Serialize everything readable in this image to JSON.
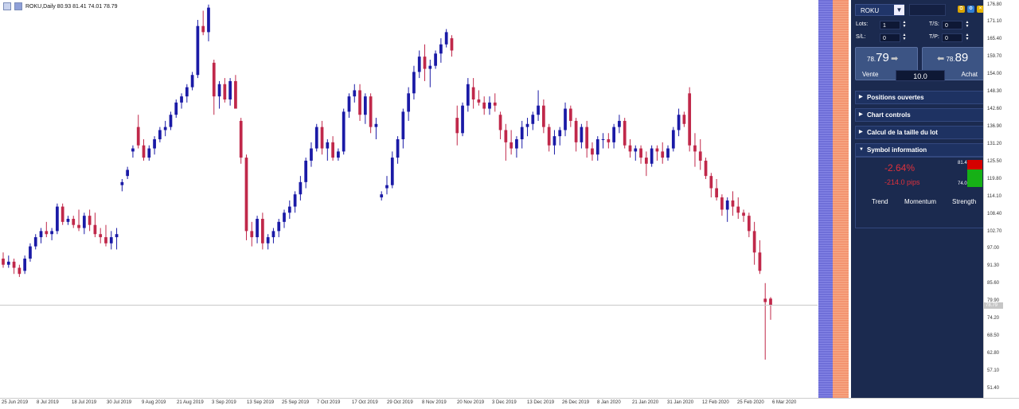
{
  "chart_header": {
    "text": "ROKU,Daily  80.93 81.41 74.01 78.79"
  },
  "price_axis": {
    "labels": [
      "176.80",
      "171.10",
      "165.40",
      "159.70",
      "154.00",
      "148.30",
      "142.60",
      "136.90",
      "131.20",
      "125.50",
      "119.80",
      "114.10",
      "108.40",
      "102.70",
      "97.00",
      "91.30",
      "85.60",
      "79.90",
      "74.20",
      "68.50",
      "62.80",
      "57.10",
      "51.40"
    ],
    "current": "78.79"
  },
  "time_axis": {
    "labels": [
      "25 Jun 2019",
      "8 Jul 2019",
      "18 Jul 2019",
      "30 Jul 2019",
      "9 Aug 2019",
      "21 Aug 2019",
      "3 Sep 2019",
      "13 Sep 2019",
      "25 Sep 2019",
      "7 Oct 2019",
      "17 Oct 2019",
      "29 Oct 2019",
      "8 Nov 2019",
      "20 Nov 2019",
      "3 Dec 2019",
      "13 Dec 2019",
      "26 Dec 2019",
      "8 Jan 2020",
      "21 Jan 2020",
      "31 Jan 2020",
      "12 Feb 2020",
      "25 Feb 2020",
      "6 Mar 2020"
    ]
  },
  "colors": {
    "bull": "#1a1aa6",
    "bear": "#c0284a",
    "panel_bg": "#1b2a4f"
  },
  "chart_data": {
    "type": "candlestick",
    "symbol": "ROKU",
    "timeframe": "Daily",
    "ylim": [
      48.5,
      178.5
    ],
    "last": {
      "open": 80.93,
      "high": 81.41,
      "low": 74.01,
      "close": 78.79
    },
    "series": [
      [
        94,
        96,
        91,
        92
      ],
      [
        92,
        95,
        91,
        93
      ],
      [
        93,
        94,
        89,
        91
      ],
      [
        91,
        92,
        88,
        89
      ],
      [
        90,
        95,
        89,
        94
      ],
      [
        94,
        99,
        93,
        98
      ],
      [
        98,
        102,
        97,
        101
      ],
      [
        101,
        104,
        99,
        103
      ],
      [
        103,
        106,
        101,
        102
      ],
      [
        102,
        104,
        100,
        103
      ],
      [
        103,
        112,
        102,
        111
      ],
      [
        111,
        112,
        105,
        106
      ],
      [
        106,
        108,
        105,
        107
      ],
      [
        107,
        108,
        104,
        105
      ],
      [
        105,
        110,
        103,
        104
      ],
      [
        104,
        109,
        102,
        108
      ],
      [
        108,
        110,
        103,
        105
      ],
      [
        105,
        109,
        101,
        102
      ],
      [
        102,
        104,
        99,
        101
      ],
      [
        101,
        105,
        98,
        99
      ],
      [
        99,
        103,
        97,
        101
      ],
      [
        101,
        104,
        97,
        102
      ],
      [
        118,
        120,
        116,
        119
      ],
      [
        121,
        124,
        120,
        123
      ],
      [
        129,
        131,
        127,
        130
      ],
      [
        137,
        141,
        130,
        131
      ],
      [
        131,
        133,
        126,
        127
      ],
      [
        127,
        131,
        126,
        130
      ],
      [
        130,
        134,
        128,
        133
      ],
      [
        133,
        137,
        132,
        136
      ],
      [
        136,
        139,
        134,
        137
      ],
      [
        137,
        142,
        136,
        141
      ],
      [
        141,
        146,
        140,
        145
      ],
      [
        145,
        148,
        143,
        147
      ],
      [
        147,
        151,
        145,
        150
      ],
      [
        150,
        155,
        149,
        154
      ],
      [
        154,
        172,
        153,
        170
      ],
      [
        170,
        175,
        167,
        168
      ],
      [
        168,
        177,
        165,
        176
      ],
      [
        158,
        159,
        141,
        147
      ],
      [
        147,
        152,
        143,
        151
      ],
      [
        151,
        153,
        145,
        146
      ],
      [
        146,
        153,
        144,
        152
      ],
      [
        152,
        154,
        145,
        143
      ],
      [
        139,
        140,
        125,
        127
      ],
      [
        127,
        128,
        100,
        103
      ],
      [
        103,
        106,
        98,
        101
      ],
      [
        101,
        108,
        99,
        107
      ],
      [
        107,
        109,
        97,
        99
      ],
      [
        99,
        102,
        97,
        101
      ],
      [
        101,
        104,
        99,
        103
      ],
      [
        103,
        107,
        101,
        106
      ],
      [
        106,
        110,
        104,
        109
      ],
      [
        109,
        113,
        107,
        111
      ],
      [
        111,
        116,
        109,
        115
      ],
      [
        115,
        121,
        113,
        119
      ],
      [
        119,
        127,
        117,
        126
      ],
      [
        126,
        132,
        124,
        130
      ],
      [
        130,
        138,
        129,
        137
      ],
      [
        137,
        139,
        128,
        130
      ],
      [
        130,
        133,
        126,
        132
      ],
      [
        132,
        134,
        126,
        127
      ],
      [
        127,
        130,
        126,
        129
      ],
      [
        129,
        143,
        128,
        142
      ],
      [
        142,
        148,
        140,
        147
      ],
      [
        147,
        151,
        145,
        149
      ],
      [
        149,
        151,
        139,
        141
      ],
      [
        141,
        148,
        138,
        147
      ],
      [
        147,
        148,
        135,
        137
      ],
      [
        137,
        140,
        133,
        138
      ],
      [
        114,
        116,
        113,
        115
      ],
      [
        117,
        121,
        115,
        118
      ],
      [
        118,
        129,
        117,
        127
      ],
      [
        127,
        134,
        125,
        133
      ],
      [
        133,
        143,
        130,
        142
      ],
      [
        142,
        150,
        139,
        148
      ],
      [
        148,
        157,
        146,
        155
      ],
      [
        155,
        162,
        153,
        160
      ],
      [
        160,
        164,
        152,
        156
      ],
      [
        156,
        159,
        150,
        157
      ],
      [
        157,
        162,
        156,
        161
      ],
      [
        161,
        166,
        158,
        164
      ],
      [
        164,
        169,
        163,
        168
      ],
      [
        166,
        167,
        160,
        162
      ],
      [
        140,
        144,
        131,
        135
      ],
      [
        135,
        145,
        134,
        144
      ],
      [
        144,
        153,
        142,
        151
      ],
      [
        150,
        153,
        143,
        146
      ],
      [
        146,
        149,
        144,
        145
      ],
      [
        145,
        147,
        141,
        143
      ],
      [
        143,
        147,
        141,
        145
      ],
      [
        145,
        148,
        142,
        144
      ],
      [
        141,
        142,
        133,
        136
      ],
      [
        136,
        138,
        126,
        132
      ],
      [
        132,
        136,
        128,
        130
      ],
      [
        130,
        134,
        127,
        133
      ],
      [
        133,
        139,
        130,
        137
      ],
      [
        137,
        140,
        134,
        138
      ],
      [
        138,
        142,
        136,
        141
      ],
      [
        141,
        149,
        139,
        144
      ],
      [
        144,
        146,
        135,
        137
      ],
      [
        137,
        138,
        129,
        131
      ],
      [
        131,
        136,
        128,
        134
      ],
      [
        134,
        137,
        131,
        136
      ],
      [
        136,
        145,
        134,
        143
      ],
      [
        143,
        144,
        137,
        139
      ],
      [
        139,
        140,
        129,
        132
      ],
      [
        132,
        138,
        130,
        137
      ],
      [
        137,
        139,
        127,
        130
      ],
      [
        130,
        132,
        126,
        128
      ],
      [
        128,
        134,
        126,
        133
      ],
      [
        133,
        135,
        130,
        133
      ],
      [
        133,
        135,
        130,
        132
      ],
      [
        132,
        138,
        130,
        137
      ],
      [
        137,
        141,
        135,
        139
      ],
      [
        139,
        140,
        130,
        131
      ],
      [
        131,
        133,
        127,
        129
      ],
      [
        129,
        131,
        126,
        130
      ],
      [
        130,
        131,
        125,
        127
      ],
      [
        127,
        129,
        121,
        125
      ],
      [
        125,
        131,
        124,
        130
      ],
      [
        130,
        131,
        126,
        129
      ],
      [
        129,
        132,
        125,
        127
      ],
      [
        127,
        131,
        126,
        130
      ],
      [
        130,
        137,
        129,
        136
      ],
      [
        136,
        143,
        134,
        141
      ],
      [
        141,
        142,
        137,
        138
      ],
      [
        148,
        150,
        129,
        131
      ],
      [
        131,
        135,
        124,
        129
      ],
      [
        129,
        133,
        123,
        126
      ],
      [
        126,
        127,
        120,
        121
      ],
      [
        121,
        122,
        114,
        117
      ],
      [
        117,
        120,
        113,
        114
      ],
      [
        114,
        115,
        108,
        110
      ],
      [
        110,
        114,
        106,
        113
      ],
      [
        113,
        116,
        108,
        111
      ],
      [
        111,
        114,
        107,
        109
      ],
      [
        109,
        110,
        106,
        108
      ],
      [
        108,
        109,
        101,
        103
      ],
      [
        103,
        106,
        92,
        96
      ],
      [
        96,
        100,
        89,
        90
      ],
      [
        80.9,
        86,
        61,
        79.8
      ],
      [
        80.93,
        81.41,
        74.01,
        78.79
      ]
    ]
  },
  "panel": {
    "symbol": "ROKU",
    "lots_label": "Lots:",
    "lots_value": "1",
    "sl_label": "S/L:",
    "sl_value": "0",
    "ts_label": "T/S:",
    "ts_value": "0",
    "tp_label": "T/P:",
    "tp_value": "0",
    "sell": {
      "prefix": "78.",
      "big": "79",
      "label": "Vente"
    },
    "buy": {
      "prefix": "78.",
      "big": "89",
      "label": "Achat"
    },
    "lot_center": "10.0",
    "sections": [
      "Positions ouvertes",
      "Chart controls",
      "Calcul de la taille du lot",
      "Symbol information"
    ],
    "symbol_info": {
      "pct": "-2.64%",
      "pips": "-214.0 pips",
      "high": "81.41",
      "low": "74.01",
      "indicators": [
        "Trend",
        "Momentum",
        "Strength"
      ]
    }
  }
}
